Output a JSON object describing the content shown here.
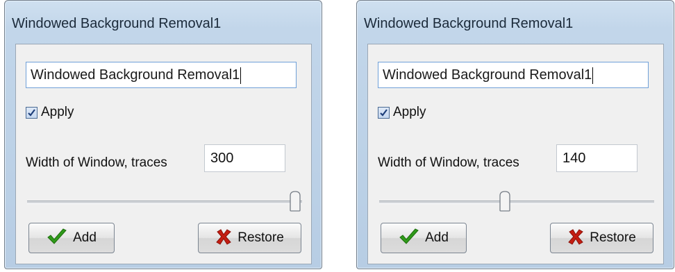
{
  "dialogs": [
    {
      "title": "Windowed Background Removal1",
      "name_value": "Windowed Background Removal1",
      "apply_label": "Apply",
      "apply_checked": true,
      "width_label": "Width of Window, traces",
      "width_value": "300",
      "slider_position": 1.0,
      "add_label": "Add",
      "restore_label": "Restore",
      "icons": {
        "add": "checkmark-icon",
        "restore": "x-cross-icon"
      }
    },
    {
      "title": "Windowed Background Removal1",
      "name_value": "Windowed Background Removal1",
      "apply_label": "Apply",
      "apply_checked": true,
      "width_label": "Width of Window, traces",
      "width_value": "140",
      "slider_position": 0.455,
      "add_label": "Add",
      "restore_label": "Restore",
      "icons": {
        "add": "checkmark-icon",
        "restore": "x-cross-icon"
      }
    }
  ],
  "colors": {
    "check_green": "#2f9a1a",
    "cross_red": "#c41e12",
    "input_focus_border": "#6fa0d8"
  }
}
